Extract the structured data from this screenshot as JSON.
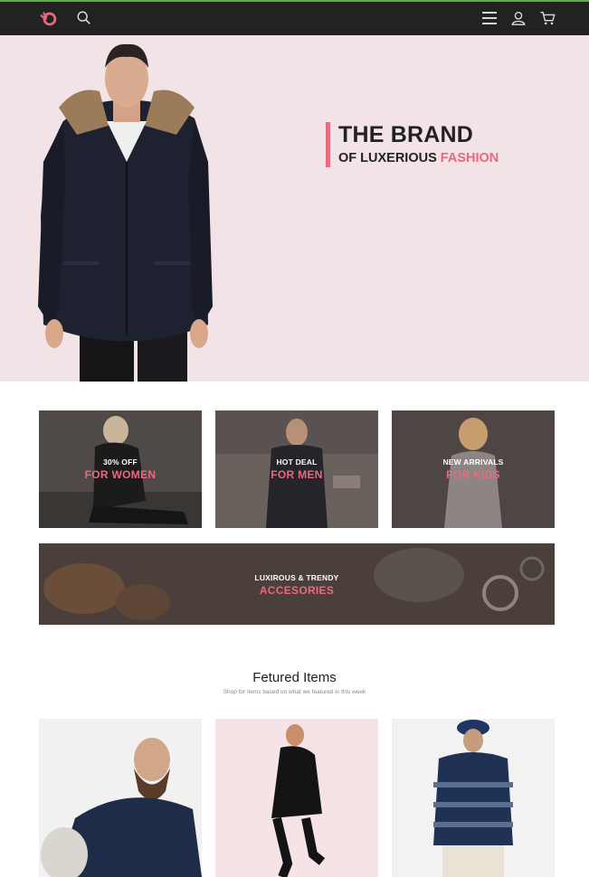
{
  "nav": {
    "logo_icon": "hand-logo-icon",
    "search_icon": "search-icon",
    "menu_icon": "menu-icon",
    "user_icon": "user-icon",
    "cart_icon": "cart-icon",
    "accent": "#5fae3a"
  },
  "hero": {
    "headline": "THE BRAND",
    "sub_prefix": "OF LUXERIOUS",
    "sub_highlight": "FASHION",
    "bg_color": "#f1e3e6",
    "accent_color": "#e86a7f"
  },
  "promos": [
    {
      "small": "30% OFF",
      "big": "FOR WOMEN"
    },
    {
      "small": "HOT DEAL",
      "big": "FOR MEN"
    },
    {
      "small": "NEW ARRIVALS",
      "big": "FOR KIDS"
    },
    {
      "small": "LUXIROUS & TRENDY",
      "big": "ACCESORIES"
    }
  ],
  "featured": {
    "title": "Fetured Items",
    "subtitle": "Shop for items based on what we featured in this week"
  }
}
